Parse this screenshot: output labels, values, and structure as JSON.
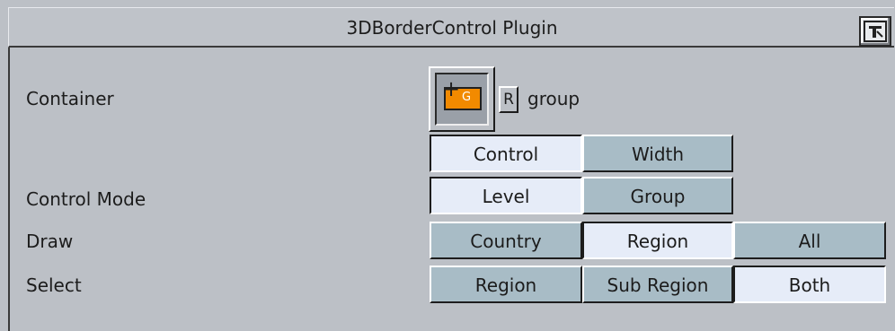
{
  "window": {
    "title": "3DBorderControl Plugin",
    "help_icon": "help-icon"
  },
  "container": {
    "label": "Container",
    "icon": "group-icon",
    "icon_letter": "G",
    "reset_label": "R",
    "value": "group"
  },
  "tabs": {
    "items": [
      {
        "label": "Control",
        "active": true
      },
      {
        "label": "Width",
        "active": false
      }
    ]
  },
  "control_mode": {
    "label": "Control Mode",
    "options": [
      {
        "label": "Level",
        "active": true
      },
      {
        "label": "Group",
        "active": false
      }
    ]
  },
  "draw": {
    "label": "Draw",
    "options": [
      {
        "label": "Country",
        "active": false
      },
      {
        "label": "Region",
        "active": true
      },
      {
        "label": "All",
        "active": false
      }
    ]
  },
  "select": {
    "label": "Select",
    "options": [
      {
        "label": "Region",
        "active": false
      },
      {
        "label": "Sub Region",
        "active": false
      },
      {
        "label": "Both",
        "active": true
      }
    ]
  },
  "colors": {
    "background": "#bcc0c6",
    "button": "#a8bcc6",
    "button_active": "#e6ecf8",
    "group_icon": "#f28a00"
  }
}
